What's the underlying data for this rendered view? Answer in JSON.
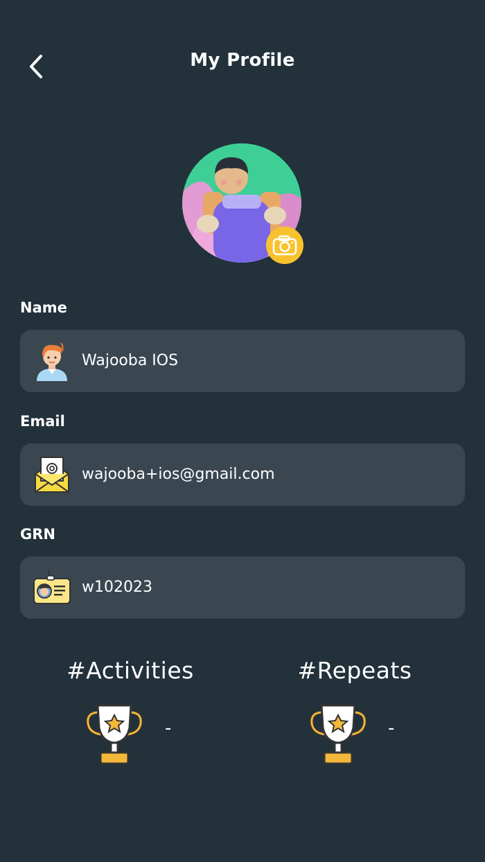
{
  "header": {
    "title": "My Profile",
    "back_icon": "chevron-left-icon"
  },
  "avatar": {
    "edit_icon": "camera-icon",
    "accent": "#f8c22f"
  },
  "fields": {
    "name": {
      "label": "Name",
      "value": "Wajooba IOS",
      "icon": "person-icon"
    },
    "email": {
      "label": "Email",
      "value": "wajooba+ios@gmail.com",
      "icon": "envelope-icon"
    },
    "grn": {
      "label": "GRN",
      "value": "w102023",
      "icon": "id-card-icon"
    }
  },
  "stats": {
    "activities": {
      "label": "#Activities",
      "value": "-",
      "icon": "trophy-icon"
    },
    "repeats": {
      "label": "#Repeats",
      "value": "-",
      "icon": "trophy-icon"
    }
  },
  "colors": {
    "background": "#22313a",
    "field": "#3a4751",
    "accent": "#f8c22f"
  }
}
